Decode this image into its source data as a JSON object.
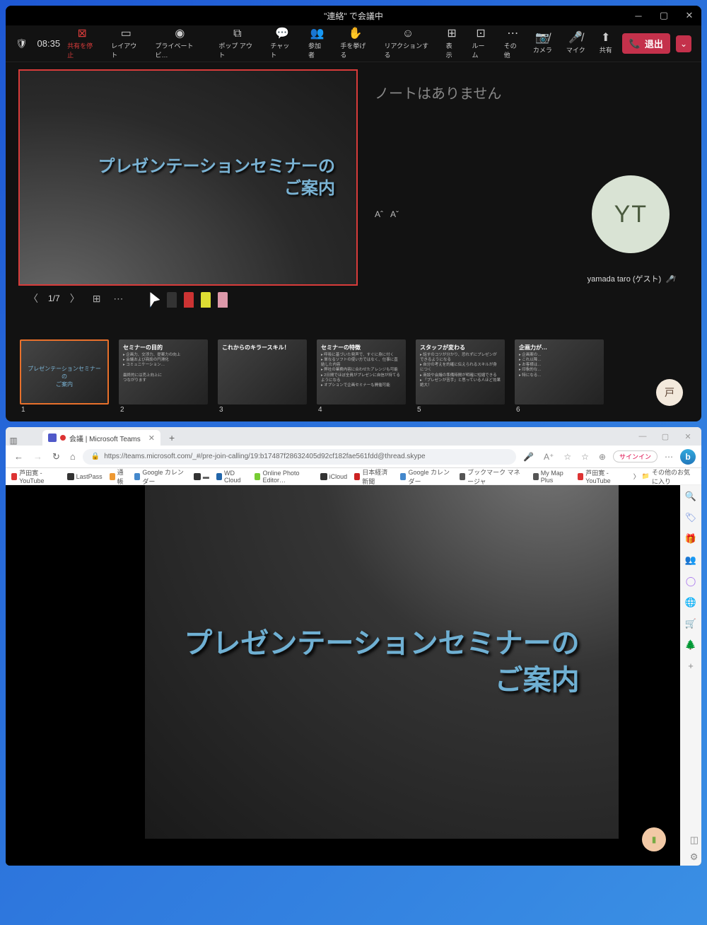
{
  "top": {
    "title": "\"連絡\" で会議中",
    "timer": "08:35",
    "toolbar": {
      "stop_share": "共有を停止",
      "layout": "レイアウト",
      "private": "プライベート ビ…",
      "popout": "ポップ アウト",
      "chat": "チャット",
      "people": "参加者",
      "raise": "手を挙げる",
      "react": "リアクションする",
      "view": "表示",
      "room": "ルーム",
      "more": "その他",
      "camera": "カメラ",
      "mic": "マイク",
      "share": "共有",
      "leave": "退出"
    },
    "slide_title_a": "プレゼンテーションセミナーの",
    "slide_title_b": "ご案内",
    "notes_empty": "ノートはありません",
    "page_indicator": "1/7",
    "font_big": "Aˆ",
    "font_small": "Aˇ",
    "participant_name": "yamada taro (ゲスト)",
    "participant_initials": "YT",
    "thumbs": [
      {
        "num": "1",
        "title_a": "プレゼンテーションセミナーの",
        "title_b": "ご案内"
      },
      {
        "num": "2",
        "hdr": "セミナーの目的",
        "bul": "▸ 企画力、交渉力、提案力の向上\n▸ 会議および商談の円滑化\n▸ コミュニケーション…\n\n最終的には売上向上に\nつながります"
      },
      {
        "num": "3",
        "hdr": "これからのキラースキル！",
        "bul": ""
      },
      {
        "num": "4",
        "hdr": "セミナーの特徴",
        "bul": "▸ 呼吸に基づいた発声で、すぐに身に付く\n▸ 単なるソフトの使い方ではなく、仕事に直結した内容\n▸ 弊社の業務内容に合わせたアレンジも可能\n▸ 2日間でほぼ全員がプレゼンに自信が持てるようになる\n▸ オプションで企画セミナーも開催可能"
      },
      {
        "num": "5",
        "hdr": "スタッフが変わる",
        "bul": "▸ 話すのコツが分かり、恐れずにプレゼンができるようになる\n▸ 自分の考えを的確に伝えられるスキルが身につく\n▸ 商談や会議の準備時間が明確に短縮できる\n▸ 「プレゼンが苦手」と思っている人ほど効果絶大！"
      },
      {
        "num": "6",
        "hdr": "企画力が…",
        "bul": "▸ 企画案の…\n▸ これ以降…\n▸ お客様は…\n▸ 印象的な…\n▸ 特になる…"
      }
    ]
  },
  "bottom": {
    "tab_title": "会議 | Microsoft Teams",
    "url": "https://teams.microsoft.com/_#/pre-join-calling/19:b17487f28632405d92cf182fae561fdd@thread.skype",
    "signin": "サインイン",
    "bookmarks": [
      "芦田寛 - YouTube",
      "LastPass",
      "通帳",
      "Google カレンダー",
      "▬",
      "WD Cloud",
      "Online Photo Editor…",
      "iCloud",
      "日本経済新聞",
      "Google カレンダー",
      "ブックマーク マネージャ",
      "My Map Plus",
      "芦田寛 - YouTube"
    ],
    "bookmark_overflow": "その他のお気に入り",
    "slide_title_a": "プレゼンテーションセミナーの",
    "slide_title_b": "ご案内"
  }
}
